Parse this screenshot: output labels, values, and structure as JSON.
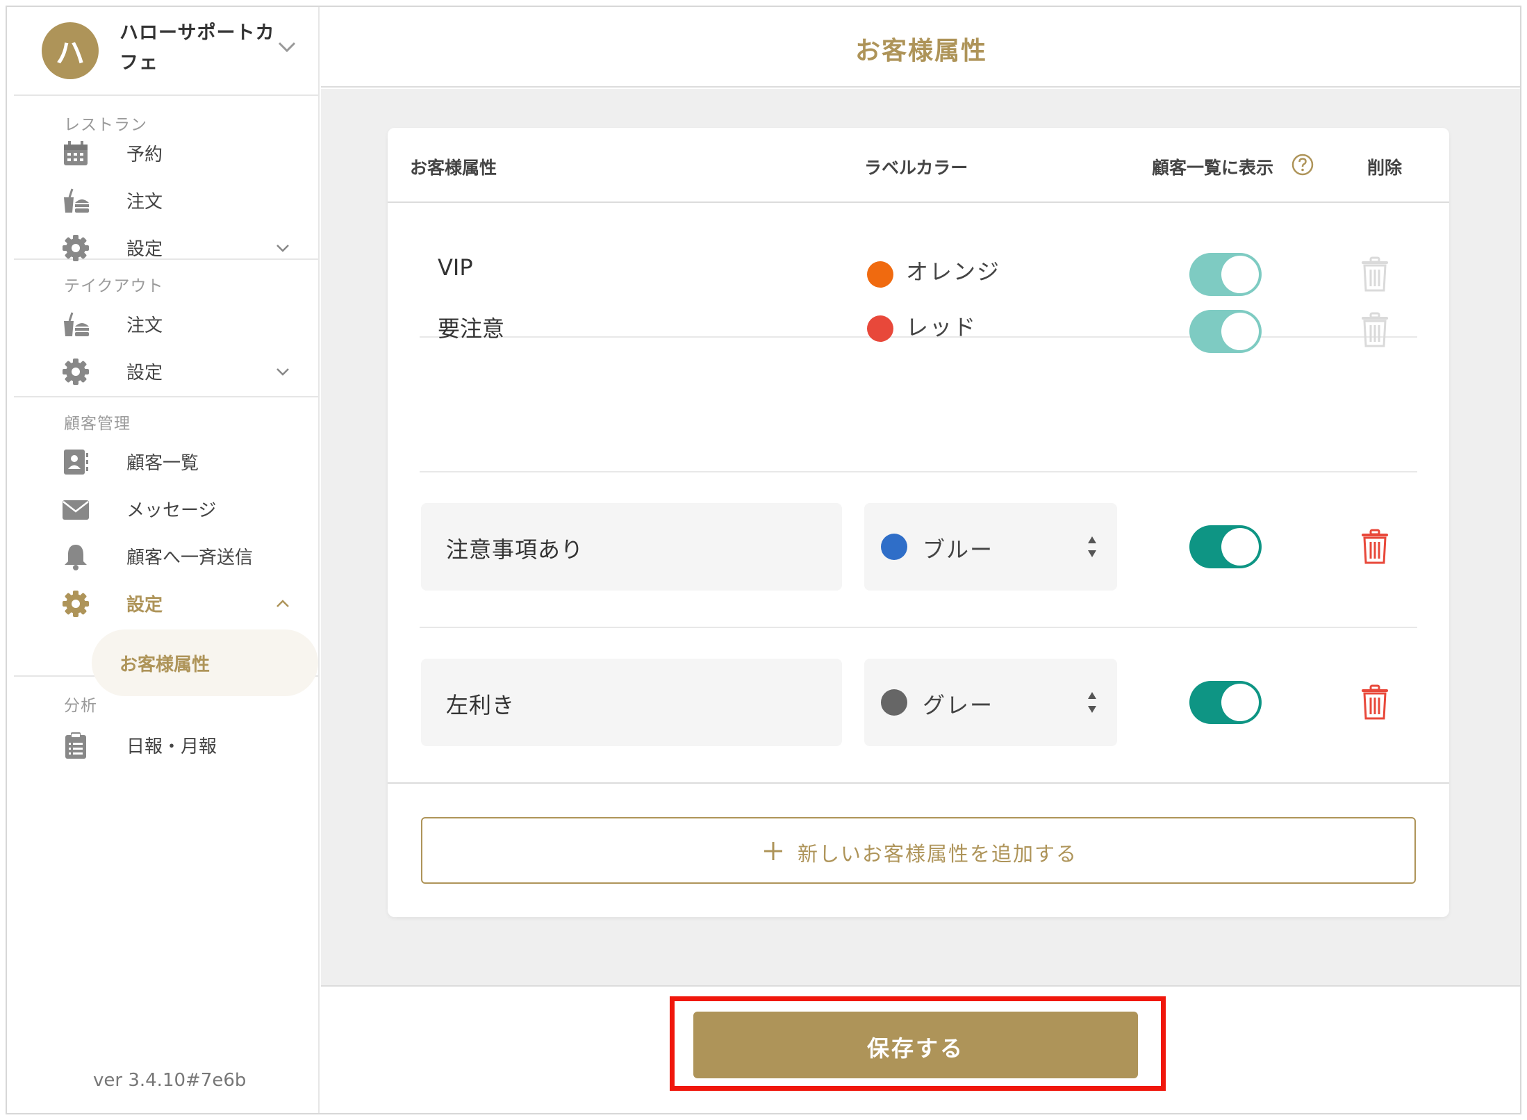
{
  "brand": {
    "initial": "ハ",
    "name": "ハローサポートカフェ"
  },
  "sidebar": {
    "sections": [
      {
        "title": "レストラン",
        "items": [
          {
            "label": "予約",
            "icon": "calendar-icon"
          },
          {
            "label": "注文",
            "icon": "takeout-icon"
          },
          {
            "label": "設定",
            "icon": "gear-icon"
          }
        ]
      },
      {
        "title": "テイクアウト",
        "items": [
          {
            "label": "注文",
            "icon": "takeout-icon"
          },
          {
            "label": "設定",
            "icon": "gear-icon"
          }
        ]
      },
      {
        "title": "顧客管理",
        "items": [
          {
            "label": "顧客一覧",
            "icon": "contact-card-icon"
          },
          {
            "label": "メッセージ",
            "icon": "envelope-icon"
          },
          {
            "label": "顧客へ一斉送信",
            "icon": "bell-icon"
          },
          {
            "label": "設定",
            "icon": "gear-icon"
          }
        ],
        "sub_item": "お客様属性"
      },
      {
        "title": "分析",
        "items": [
          {
            "label": "日報・月報",
            "icon": "clipboard-icon"
          }
        ]
      }
    ],
    "version": "ver 3.4.10#7e6b"
  },
  "page": {
    "title": "お客様属性"
  },
  "table": {
    "headers": {
      "attribute": "お客様属性",
      "label_color": "ラベルカラー",
      "show_in_list": "顧客一覧に表示",
      "delete": "削除"
    },
    "rows": [
      {
        "name": "VIP",
        "color_name": "オレンジ",
        "color": "#f06a0f",
        "show": true,
        "editable": false
      },
      {
        "name": "要注意",
        "color_name": "レッド",
        "color": "#e8483a",
        "show": true,
        "editable": false
      },
      {
        "name": "注意事項あり",
        "color_name": "ブルー",
        "color": "#2f6ec8",
        "show": true,
        "editable": true
      },
      {
        "name": "左利き",
        "color_name": "グレー",
        "color": "#666666",
        "show": true,
        "editable": true
      }
    ],
    "add_label": "新しいお客様属性を追加する"
  },
  "footer": {
    "save_label": "保存する"
  },
  "colors": {
    "accent": "#ae9459",
    "toggle_on": "#0e9584",
    "toggle_on_disabled": "#7ecbc2",
    "danger": "#e8483a",
    "highlight": "#f0170c"
  }
}
